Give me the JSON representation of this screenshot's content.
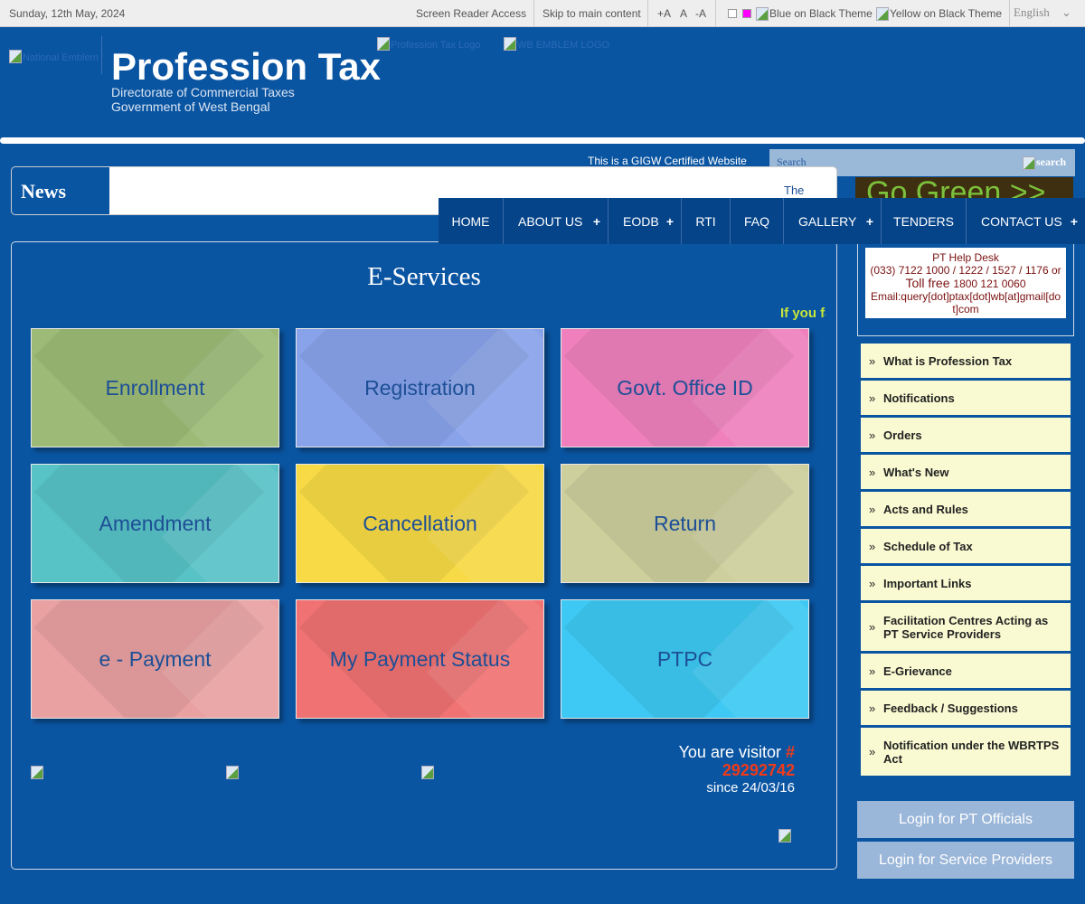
{
  "topbar": {
    "date": "Sunday, 12th May, 2024",
    "screen_reader": "Screen Reader Access",
    "skip": "Skip to main content",
    "font_plus": "+A",
    "font_normal": "A",
    "font_minus": "-A",
    "theme_blue": "Blue on Black Theme",
    "theme_yellow": "Yellow on Black Theme",
    "language": "English"
  },
  "header": {
    "emblem_alt": "National Emblem",
    "title": "Profession Tax",
    "subtitle1": "Directorate of Commercial Taxes",
    "subtitle2": "Government of West Bengal",
    "pt_logo_alt": "Profession Tax Logo",
    "wb_logo_alt": "WB EMBLEM LOGO"
  },
  "gigw": "This is a GIGW Certified Website",
  "search": {
    "placeholder": "Search",
    "button": "search"
  },
  "go_green": "Go Green >>",
  "news": {
    "label": "News",
    "ticker": "The"
  },
  "nav": [
    {
      "label": "HOME",
      "plus": false
    },
    {
      "label": "ABOUT US",
      "plus": true
    },
    {
      "label": "EODB",
      "plus": true
    },
    {
      "label": "RTI",
      "plus": false
    },
    {
      "label": "FAQ",
      "plus": false
    },
    {
      "label": "GALLERY",
      "plus": true
    },
    {
      "label": "TENDERS",
      "plus": false
    },
    {
      "label": "CONTACT US",
      "plus": true
    }
  ],
  "eservices": {
    "title": "E-Services",
    "marquee": "If you fa",
    "tiles": [
      {
        "label": "Enrollment",
        "color": "#9dbb76"
      },
      {
        "label": "Registration",
        "color": "#89a3ea"
      },
      {
        "label": "Govt. Office ID",
        "color": "#ef80bd"
      },
      {
        "label": "Amendment",
        "color": "#58c3c7"
      },
      {
        "label": "Cancellation",
        "color": "#f7da45"
      },
      {
        "label": "Return",
        "color": "#cdcf9d"
      },
      {
        "label": "e - Payment",
        "color": "#e9a1a1"
      },
      {
        "label": "My Payment Status",
        "color": "#f07272"
      },
      {
        "label": "PTPC",
        "color": "#3dc9f3"
      }
    ]
  },
  "visitor": {
    "prefix": "You are visitor",
    "hash": "#",
    "count": "29292742",
    "since": "since 24/03/16"
  },
  "helpdesk": {
    "title": "PT Help Desk",
    "phones": "(033) 7122 1000 / 1222 / 1527 / 1176 or",
    "tollfree_label": "Toll free",
    "tollfree": "1800 121 0060",
    "email_label": "Email:",
    "email": "query[dot]ptax[dot]wb[at]gmail[dot]com"
  },
  "sidebar": [
    "What is Profession Tax",
    "Notifications",
    "Orders",
    "What's New",
    "Acts and Rules",
    "Schedule of Tax",
    "Important Links",
    "Facilitation Centres Acting as PT Service Providers",
    "E-Grievance",
    "Feedback / Suggestions",
    "Notification under the WBRTPS Act"
  ],
  "login": {
    "officials": "Login for PT Officials",
    "providers": "Login for Service Providers"
  }
}
